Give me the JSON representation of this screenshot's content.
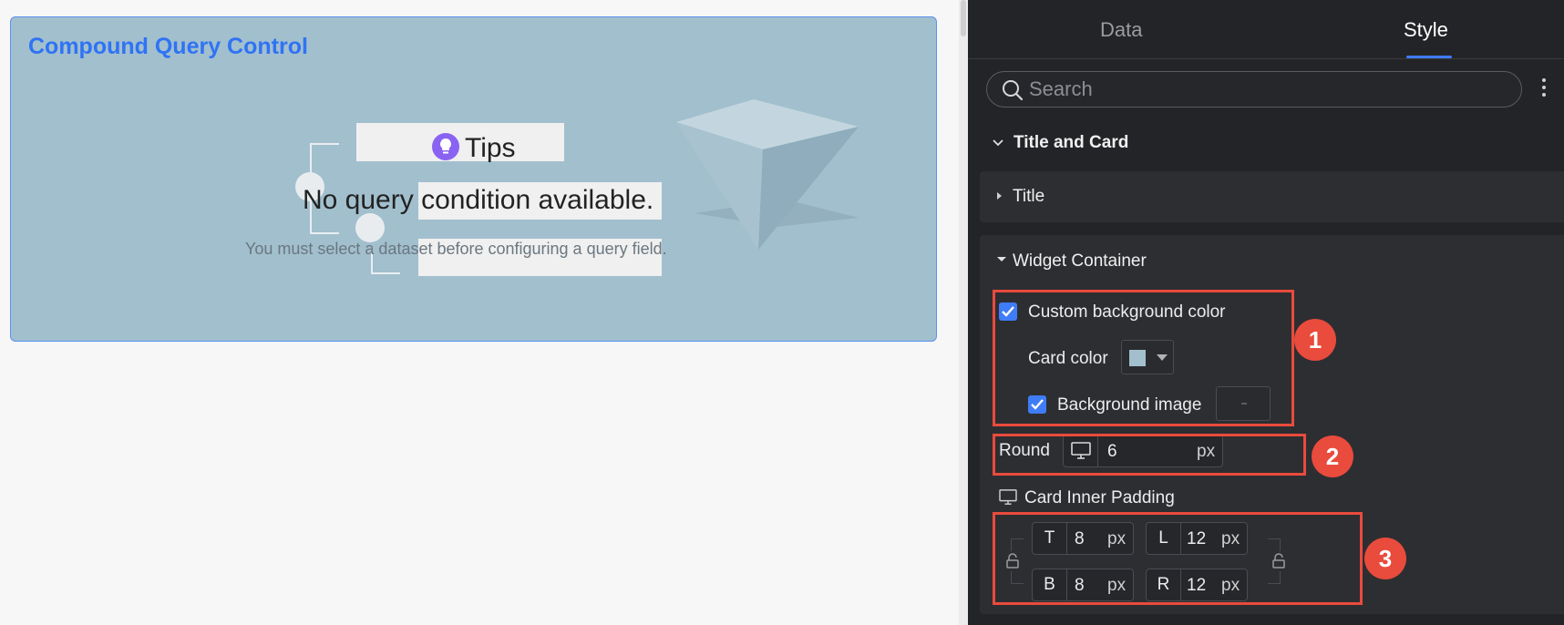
{
  "canvas": {
    "card_title": "Compound Query Control",
    "tips_label": "Tips",
    "empty_title": "No query condition available.",
    "empty_hint": "You must select a dataset before configuring a query field.",
    "card_color": "#a2bfcd"
  },
  "panel": {
    "tabs": [
      {
        "label": "Data",
        "active": false
      },
      {
        "label": "Style",
        "active": true
      }
    ],
    "search_placeholder": "Search",
    "section_title": "Title and Card",
    "groups": {
      "title_label": "Title",
      "widget_label": "Widget Container"
    },
    "widget": {
      "custom_bg_label": "Custom background color",
      "custom_bg_checked": true,
      "card_color_label": "Card color",
      "bg_image_label": "Background image",
      "bg_image_checked": true,
      "round_label": "Round",
      "round_value": "6",
      "round_unit": "px",
      "padding_label": "Card Inner Padding",
      "padding": {
        "top": {
          "key": "T",
          "value": "8",
          "unit": "px"
        },
        "bottom": {
          "key": "B",
          "value": "8",
          "unit": "px"
        },
        "left": {
          "key": "L",
          "value": "12",
          "unit": "px"
        },
        "right": {
          "key": "R",
          "value": "12",
          "unit": "px"
        }
      }
    },
    "callouts": [
      "1",
      "2",
      "3"
    ],
    "accent": "#3e7bfa",
    "callout_color": "#e94b3c"
  }
}
